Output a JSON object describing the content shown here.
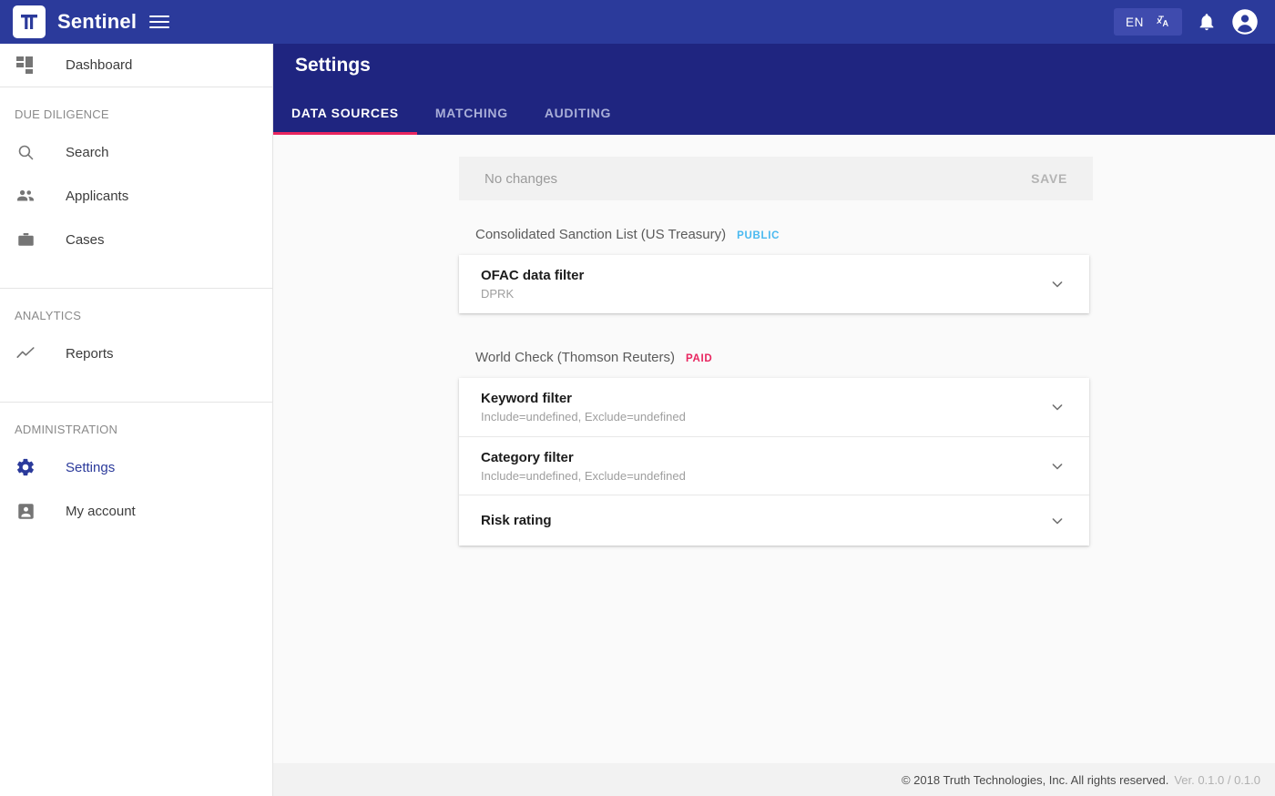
{
  "appbar": {
    "brand": "Sentinel",
    "logo_icon": "tt-logo-icon",
    "menu_icon": "hamburger-menu-icon",
    "language": "EN",
    "translate_icon": "translate-icon",
    "notifications_icon": "bell-icon",
    "account_icon": "account-avatar-icon"
  },
  "sidebar": {
    "dashboard": {
      "label": "Dashboard",
      "icon": "dashboard-grid-icon"
    },
    "sections": [
      {
        "title": "DUE DILIGENCE",
        "items": [
          {
            "label": "Search",
            "icon": "search-icon",
            "active": false
          },
          {
            "label": "Applicants",
            "icon": "people-icon",
            "active": false
          },
          {
            "label": "Cases",
            "icon": "briefcase-icon",
            "active": false
          }
        ]
      },
      {
        "title": "ANALYTICS",
        "items": [
          {
            "label": "Reports",
            "icon": "trending-up-icon",
            "active": false
          }
        ]
      },
      {
        "title": "ADMINISTRATION",
        "items": [
          {
            "label": "Settings",
            "icon": "gear-icon",
            "active": true
          },
          {
            "label": "My account",
            "icon": "account-box-icon",
            "active": false
          }
        ]
      }
    ]
  },
  "header": {
    "title": "Settings",
    "tabs": [
      {
        "label": "DATA SOURCES",
        "active": true
      },
      {
        "label": "MATCHING",
        "active": false
      },
      {
        "label": "AUDITING",
        "active": false
      }
    ]
  },
  "savebar": {
    "status": "No changes",
    "save_label": "SAVE"
  },
  "groups": [
    {
      "name": "Consolidated Sanction List (US Treasury)",
      "badge": "PUBLIC",
      "badge_type": "public",
      "panels": [
        {
          "title": "OFAC data filter",
          "subtitle": "DPRK",
          "chevron": "chevron-down-icon"
        }
      ]
    },
    {
      "name": "World Check (Thomson Reuters)",
      "badge": "PAID",
      "badge_type": "paid",
      "panels": [
        {
          "title": "Keyword filter",
          "subtitle": "Include=undefined, Exclude=undefined",
          "chevron": "chevron-down-icon"
        },
        {
          "title": "Category filter",
          "subtitle": "Include=undefined, Exclude=undefined",
          "chevron": "chevron-down-icon"
        },
        {
          "title": "Risk rating",
          "subtitle": "",
          "chevron": "chevron-down-icon"
        }
      ]
    }
  ],
  "footer": {
    "copyright": "© 2018 Truth Technologies, Inc. All rights reserved.",
    "version": "Ver. 0.1.0 / 0.1.0"
  },
  "colors": {
    "appbar": "#2b3a9b",
    "header": "#1f2580",
    "accent": "#e8255f",
    "public_badge": "#49b9f0",
    "paid_badge": "#e8255f",
    "active_nav": "#2b3a9b"
  }
}
